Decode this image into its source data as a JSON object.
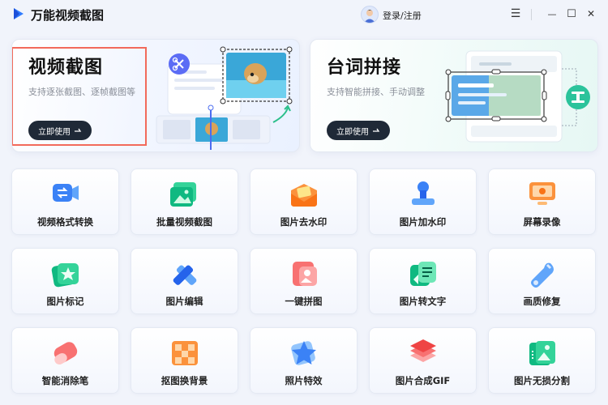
{
  "app": {
    "title": "万能视频截图",
    "login": "登录/注册"
  },
  "window_controls": {
    "menu": "☰",
    "minimize": "—",
    "maximize": "☐",
    "close": "✕"
  },
  "heroes": [
    {
      "title": "视频截图",
      "subtitle": "支持逐张截图、逐帧截图等",
      "button": "立即使用"
    },
    {
      "title": "台词拼接",
      "subtitle": "支持智能拼接、手动调整",
      "button": "立即使用"
    }
  ],
  "tools": [
    {
      "label": "视频格式转换",
      "icon": "video-convert-icon"
    },
    {
      "label": "批量视频截图",
      "icon": "batch-screenshot-icon"
    },
    {
      "label": "图片去水印",
      "icon": "remove-watermark-icon"
    },
    {
      "label": "图片加水印",
      "icon": "add-watermark-icon"
    },
    {
      "label": "屏幕录像",
      "icon": "screen-record-icon"
    },
    {
      "label": "图片标记",
      "icon": "image-mark-icon"
    },
    {
      "label": "图片编辑",
      "icon": "image-edit-icon"
    },
    {
      "label": "一键拼图",
      "icon": "collage-icon"
    },
    {
      "label": "图片转文字",
      "icon": "image-to-text-icon"
    },
    {
      "label": "画质修复",
      "icon": "quality-repair-icon"
    },
    {
      "label": "智能消除笔",
      "icon": "smart-eraser-icon"
    },
    {
      "label": "抠图换背景",
      "icon": "cutout-background-icon"
    },
    {
      "label": "照片特效",
      "icon": "photo-effects-icon"
    },
    {
      "label": "图片合成GIF",
      "icon": "gif-maker-icon"
    },
    {
      "label": "图片无损分割",
      "icon": "image-split-icon"
    }
  ]
}
